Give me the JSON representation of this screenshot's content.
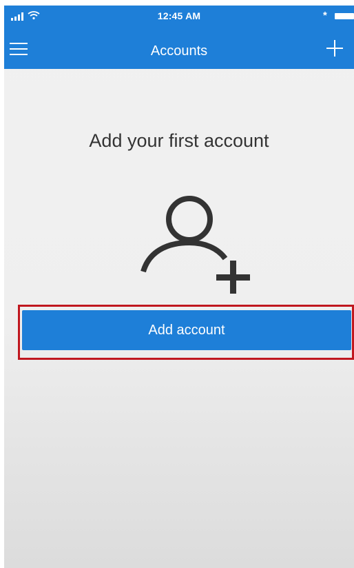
{
  "status_bar": {
    "time": "12:45 AM",
    "bluetooth_glyph": "*",
    "icons": [
      "signal-icon",
      "wifi-icon",
      "bluetooth-icon",
      "battery-icon"
    ]
  },
  "nav_bar": {
    "title": "Accounts",
    "left_icon": "menu-icon",
    "right_icon": "add-icon"
  },
  "empty_state": {
    "heading": "Add your first account",
    "icon": "add-person-icon",
    "button_label": "Add account"
  },
  "colors": {
    "accent": "#1e7fd8",
    "highlight": "#c0171f",
    "background": "#f0f0f0",
    "text": "#333333"
  }
}
